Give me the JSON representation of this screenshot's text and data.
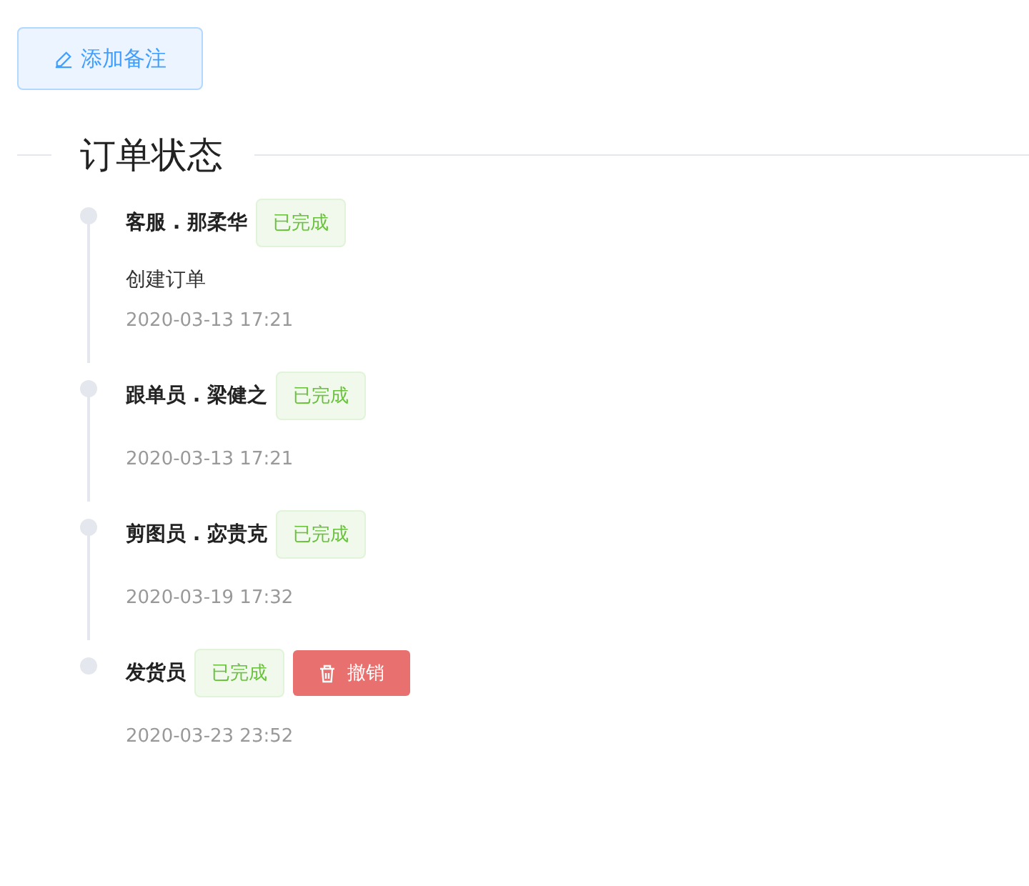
{
  "add_note_button": {
    "label": "添加备注"
  },
  "section": {
    "title": "订单状态"
  },
  "timeline": [
    {
      "title": "客服 . 那柔华",
      "tag": "已完成",
      "note": "创建订单",
      "time": "2020-03-13 17:21"
    },
    {
      "title": "跟单员 . 梁健之",
      "tag": "已完成",
      "time": "2020-03-13 17:21"
    },
    {
      "title": "剪图员 . 宓贵克",
      "tag": "已完成",
      "time": "2020-03-19 17:32"
    },
    {
      "title": "发货员",
      "tag": "已完成",
      "action": "撤销",
      "time": "2020-03-23 23:52"
    }
  ]
}
